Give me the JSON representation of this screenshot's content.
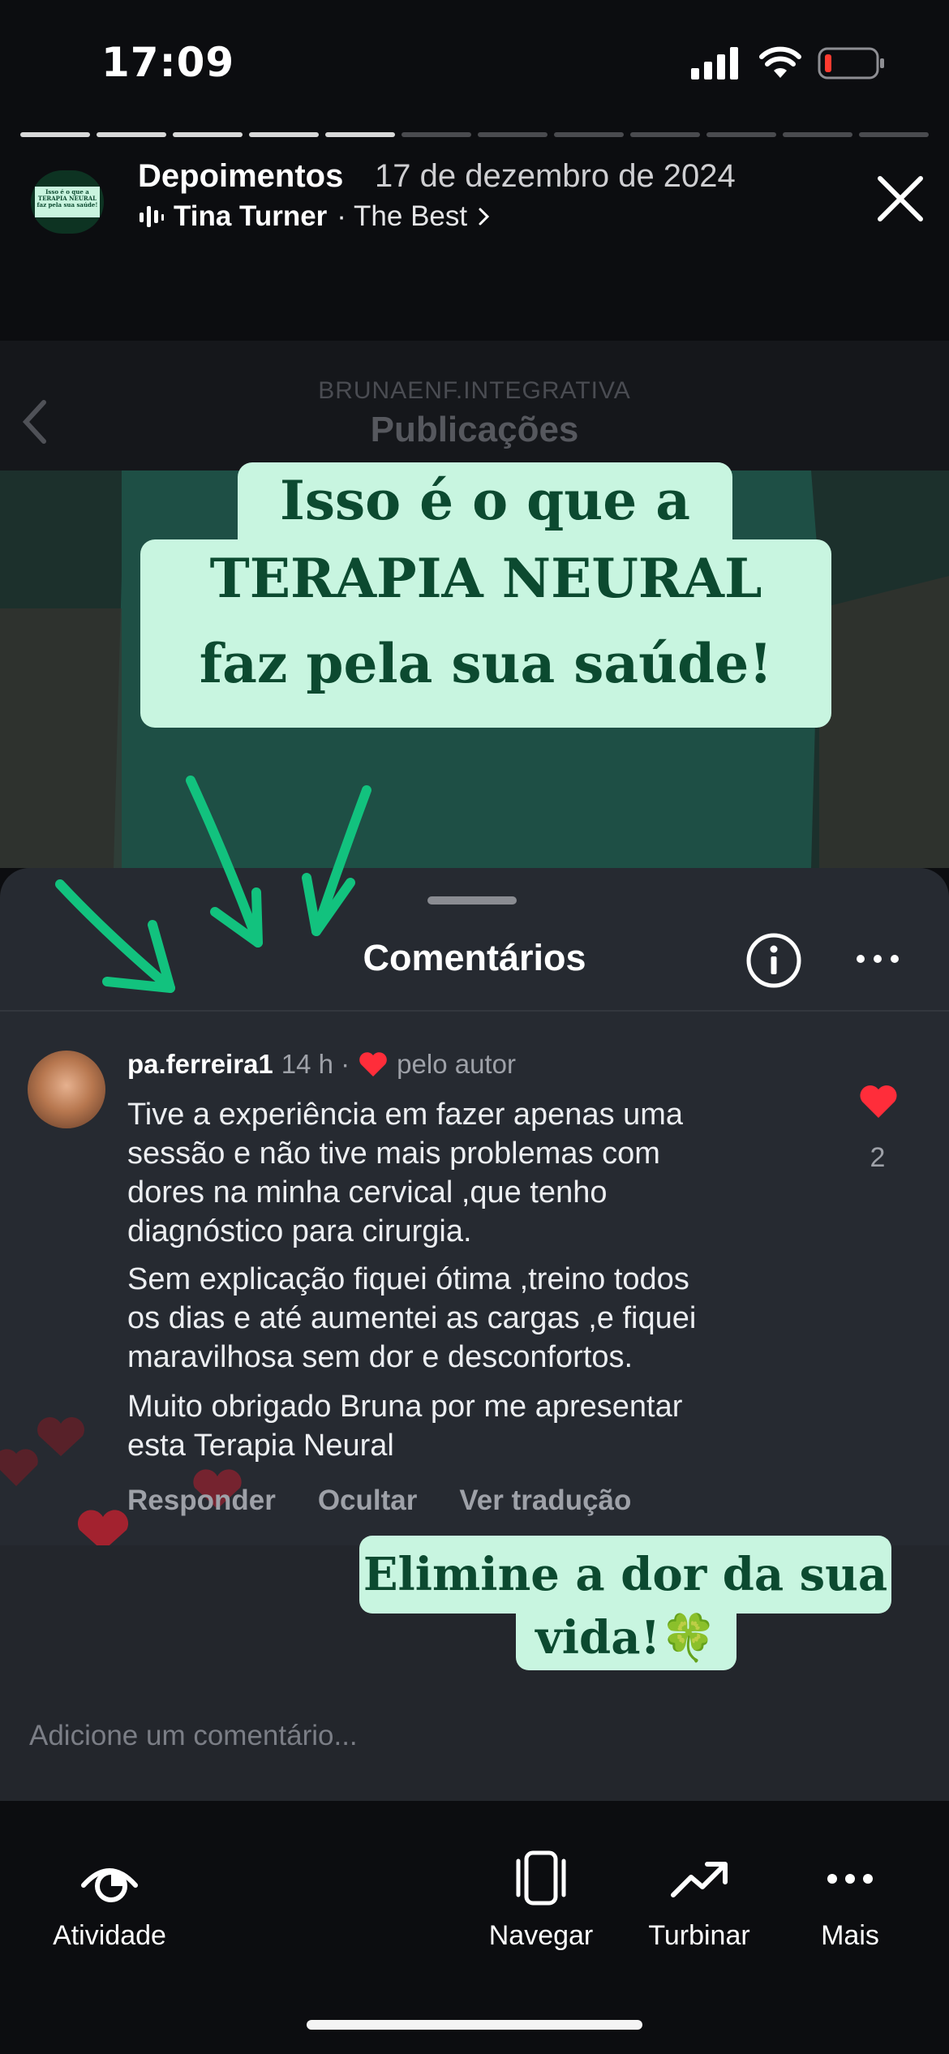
{
  "status_bar": {
    "time": "17:09"
  },
  "story": {
    "progress": {
      "total_segments": 12,
      "completed_segments": 5
    },
    "title": "Depoimentos",
    "date": "17 de dezembro de 2024",
    "music": {
      "artist": "Tina Turner",
      "song": "· The Best"
    }
  },
  "post": {
    "account": "BRUNAENF.INTEGRATIVA",
    "section": "Publicações"
  },
  "headline": {
    "line1": "Isso é o que a",
    "line2": "TERAPIA NEURAL",
    "line3": "faz pela sua saúde!"
  },
  "comments_panel": {
    "title": "Comentários",
    "comment": {
      "username": "pa.ferreira1",
      "time": "14 h ·",
      "liked_by_author": "pelo autor",
      "paragraphs": [
        [
          "Tive a experiência em fazer apenas uma",
          "sessão e não tive mais problemas  com",
          "dores na minha cervical ,que tenho",
          "diagnóstico para cirurgia."
        ],
        [
          "Sem explicação fiquei ótima ,treino todos",
          "os dias e até aumentei as cargas ,e fiquei",
          "maravilhosa sem dor e desconfortos."
        ],
        [
          "Muito obrigado Bruna por me apresentar",
          "esta Terapia Neural"
        ]
      ],
      "actions": [
        "Responder",
        "Ocultar",
        "Ver tradução"
      ],
      "like_count": "2"
    },
    "add_comment_placeholder": "Adicione um comentário..."
  },
  "footer_sticker": {
    "line1": "Elimine a dor da sua",
    "line2": "vida!🍀"
  },
  "bottom_nav": [
    {
      "label": "Atividade",
      "icon": "eye-icon"
    },
    {
      "label": "Navegar",
      "icon": "browse-icon"
    },
    {
      "label": "Turbinar",
      "icon": "trending-up-icon"
    },
    {
      "label": "Mais",
      "icon": "more-horizontal-icon"
    }
  ],
  "colors": {
    "sticker_bg": "#c8f5e0",
    "sticker_text": "#0c4a30",
    "arrow_green": "#12c27e",
    "heart_red": "#ff2d3a"
  }
}
